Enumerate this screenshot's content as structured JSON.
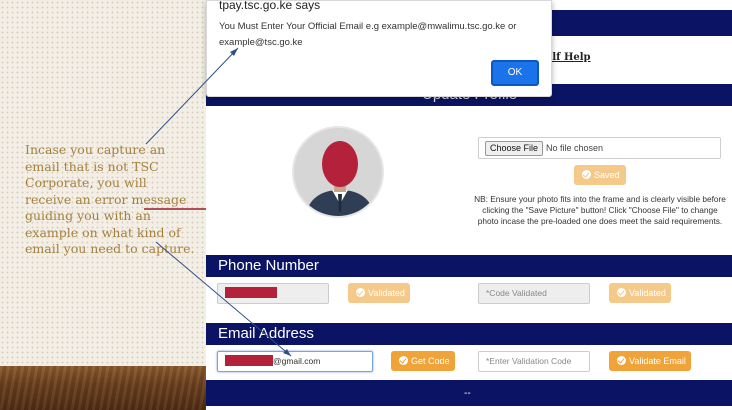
{
  "slide": {
    "note": "Incase you capture an email that is not TSC Corporate, you will receive an error message guiding you with an example on what kind of email you need to capture."
  },
  "dialog": {
    "title": "tpay.tsc.go.ke says",
    "message": "You Must Enter Your Official Email e.g example@mwalimu.tsc.go.ke or example@tsc.go.ke",
    "ok_label": "OK"
  },
  "header": {
    "self_help": "elf Help",
    "profile_title": "Update Profile"
  },
  "profile": {
    "choose_file_label": "Choose File",
    "file_status": "No file chosen",
    "saved_label": "Saved",
    "note": "NB: Ensure your photo fits into the frame and is clearly visible before clicking the \"Save Picture\" button! Click \"Choose File\" to change photo incase the pre-loaded one does meet the said requirements."
  },
  "phone": {
    "title": "Phone Number",
    "validated_label": "Validated",
    "code_placeholder": "*Code Validated",
    "validated2_label": "Validated"
  },
  "email": {
    "title": "Email Address",
    "value_suffix": "@gmail.com",
    "get_code_label": "Get Code",
    "code_placeholder": "*Enter Validation Code",
    "validate_label": "Validate Email"
  },
  "footer": {
    "text": "--"
  },
  "colors": {
    "navy": "#0b1464",
    "orange": "#f0a338",
    "note_gold": "#a6803e"
  }
}
